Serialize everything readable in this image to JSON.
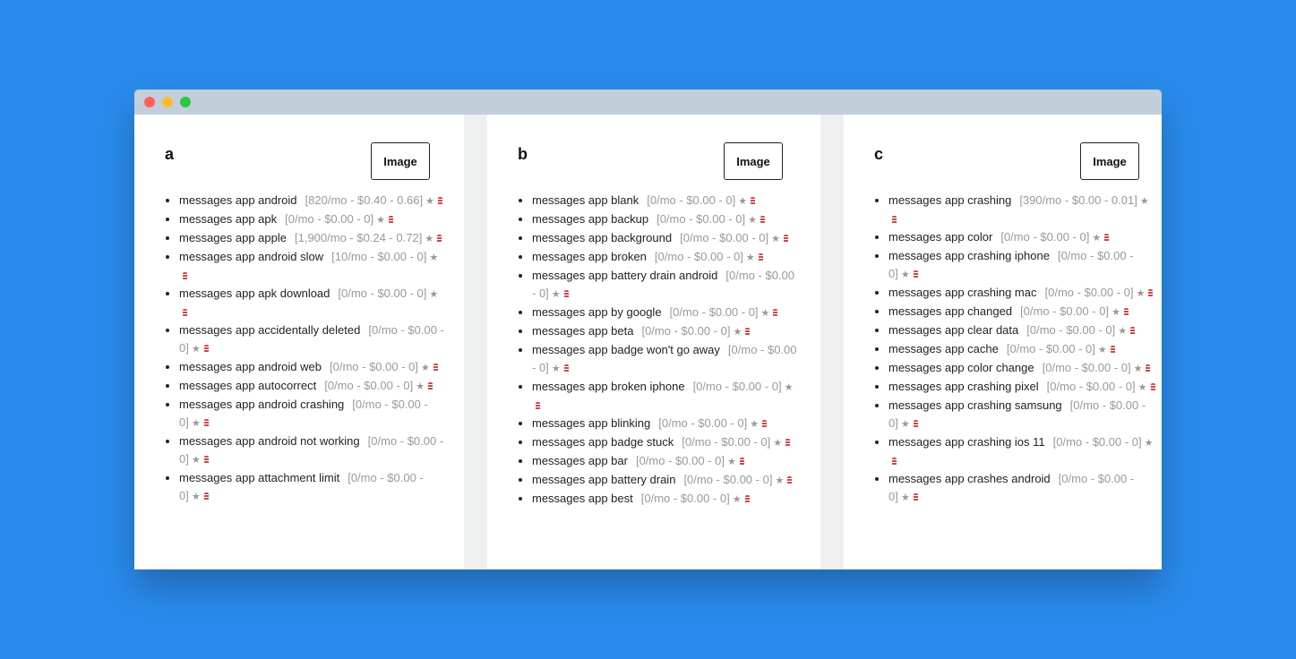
{
  "window": {
    "controls": [
      "close",
      "minimize",
      "maximize"
    ]
  },
  "colors": {
    "background": "#2a8bec",
    "titlebar": "#c2cfdb",
    "stats": "#999999",
    "db_icon": "#d0454b"
  },
  "columns": [
    {
      "title": "a",
      "button": "Image",
      "items": [
        {
          "keyword": "messages app android",
          "stats": "[820/mo - $0.40 - 0.66]"
        },
        {
          "keyword": "messages app apk",
          "stats": "[0/mo - $0.00 - 0]"
        },
        {
          "keyword": "messages app apple",
          "stats": "[1,900/mo - $0.24 - 0.72]"
        },
        {
          "keyword": "messages app android slow",
          "stats": "[10/mo - $0.00 - 0]"
        },
        {
          "keyword": "messages app apk download",
          "stats": "[0/mo - $0.00 - 0]"
        },
        {
          "keyword": "messages app accidentally deleted",
          "stats": "[0/mo - $0.00 - 0]"
        },
        {
          "keyword": "messages app android web",
          "stats": "[0/mo - $0.00 - 0]"
        },
        {
          "keyword": "messages app autocorrect",
          "stats": "[0/mo - $0.00 - 0]"
        },
        {
          "keyword": "messages app android crashing",
          "stats": "[0/mo - $0.00 - 0]"
        },
        {
          "keyword": "messages app android not working",
          "stats": "[0/mo - $0.00 - 0]"
        },
        {
          "keyword": "messages app attachment limit",
          "stats": "[0/mo - $0.00 - 0]"
        }
      ]
    },
    {
      "title": "b",
      "button": "Image",
      "items": [
        {
          "keyword": "messages app blank",
          "stats": "[0/mo - $0.00 - 0]"
        },
        {
          "keyword": "messages app backup",
          "stats": "[0/mo - $0.00 - 0]"
        },
        {
          "keyword": "messages app background",
          "stats": "[0/mo - $0.00 - 0]"
        },
        {
          "keyword": "messages app broken",
          "stats": "[0/mo - $0.00 - 0]"
        },
        {
          "keyword": "messages app battery drain android",
          "stats": "[0/mo - $0.00 - 0]"
        },
        {
          "keyword": "messages app by google",
          "stats": "[0/mo - $0.00 - 0]"
        },
        {
          "keyword": "messages app beta",
          "stats": "[0/mo - $0.00 - 0]"
        },
        {
          "keyword": "messages app badge won't go away",
          "stats": "[0/mo - $0.00 - 0]"
        },
        {
          "keyword": "messages app broken iphone",
          "stats": "[0/mo - $0.00 - 0]"
        },
        {
          "keyword": "messages app blinking",
          "stats": "[0/mo - $0.00 - 0]"
        },
        {
          "keyword": "messages app badge stuck",
          "stats": "[0/mo - $0.00 - 0]"
        },
        {
          "keyword": "messages app bar",
          "stats": "[0/mo - $0.00 - 0]"
        },
        {
          "keyword": "messages app battery drain",
          "stats": "[0/mo - $0.00 - 0]"
        },
        {
          "keyword": "messages app best",
          "stats": "[0/mo - $0.00 - 0]"
        }
      ]
    },
    {
      "title": "c",
      "button": "Image",
      "items": [
        {
          "keyword": "messages app crashing",
          "stats": "[390/mo - $0.00 - 0.01]"
        },
        {
          "keyword": "messages app color",
          "stats": "[0/mo - $0.00 - 0]"
        },
        {
          "keyword": "messages app crashing iphone",
          "stats": "[0/mo - $0.00 - 0]"
        },
        {
          "keyword": "messages app crashing mac",
          "stats": "[0/mo - $0.00 - 0]"
        },
        {
          "keyword": "messages app changed",
          "stats": "[0/mo - $0.00 - 0]"
        },
        {
          "keyword": "messages app clear data",
          "stats": "[0/mo - $0.00 - 0]"
        },
        {
          "keyword": "messages app cache",
          "stats": "[0/mo - $0.00 - 0]"
        },
        {
          "keyword": "messages app color change",
          "stats": "[0/mo - $0.00 - 0]"
        },
        {
          "keyword": "messages app crashing pixel",
          "stats": "[0/mo - $0.00 - 0]"
        },
        {
          "keyword": "messages app crashing samsung",
          "stats": "[0/mo - $0.00 - 0]"
        },
        {
          "keyword": "messages app crashing ios 11",
          "stats": "[0/mo - $0.00 - 0]"
        },
        {
          "keyword": "messages app crashes android",
          "stats": "[0/mo - $0.00 - 0]"
        }
      ]
    }
  ]
}
